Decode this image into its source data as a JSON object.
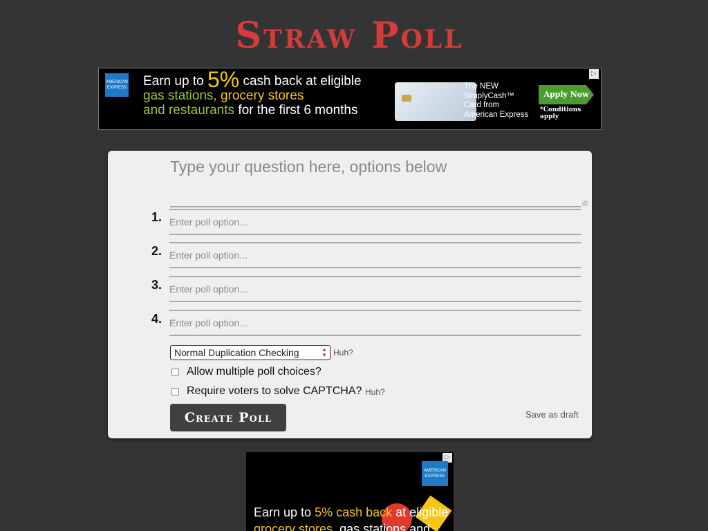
{
  "site": {
    "logo": "Straw Poll"
  },
  "ad_top": {
    "line1_pre": "Earn up to",
    "line1_pct": "5%",
    "line1_post": "cash back at eligible",
    "line2_a": "gas stations,",
    "line2_b": "grocery stores",
    "line3_a": "and restaurants",
    "line3_b": "for the first 6 months",
    "card_line1": "The NEW",
    "card_line2": "SimplyCash™",
    "card_line3": "Card from",
    "card_line4": "American Express",
    "apply": "Apply Now",
    "conditions": "*Conditions apply",
    "brand": "AMERICAN EXPRESS"
  },
  "form": {
    "question_placeholder": "Type your question here, options below",
    "options": [
      {
        "num": "1.",
        "placeholder": "Enter poll option..."
      },
      {
        "num": "2.",
        "placeholder": "Enter poll option..."
      },
      {
        "num": "3.",
        "placeholder": "Enter poll option..."
      },
      {
        "num": "4.",
        "placeholder": "Enter poll option..."
      }
    ],
    "dup_select": "Normal Duplication Checking",
    "huh": "Huh?",
    "allow_multiple": "Allow multiple poll choices?",
    "captcha": "Require voters to solve CAPTCHA?",
    "create_button": "Create Poll",
    "save_draft": "Save as draft"
  },
  "ad_bottom": {
    "line1_pre": "Earn up to",
    "line1_yel": "5% cash back",
    "line1_post": "at eligible",
    "line2_yel": "grocery stores,",
    "line2_post": "gas stations and",
    "brand": "AMERICAN EXPRESS"
  },
  "icons": {
    "adchoices": "adchoices-icon",
    "select": "select-arrows-icon"
  },
  "colors": {
    "background": "#343434",
    "logo": "#d43c3c",
    "panel": "#efefef",
    "button": "#404040",
    "ad_accent": "#f5c518"
  }
}
